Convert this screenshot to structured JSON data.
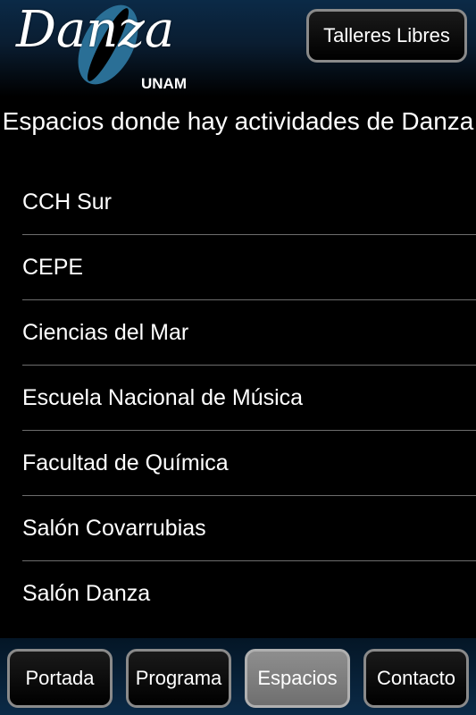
{
  "header": {
    "logo_title": "Danza",
    "logo_subtitle": "UNAM",
    "top_button_label": "Talleres Libres"
  },
  "page": {
    "title": "Espacios donde hay actividades de Danza"
  },
  "spaces": [
    {
      "label": "CCH Sur"
    },
    {
      "label": "CEPE"
    },
    {
      "label": "Ciencias del Mar"
    },
    {
      "label": "Escuela Nacional de Música"
    },
    {
      "label": "Facultad de Química"
    },
    {
      "label": "Salón Covarrubias"
    },
    {
      "label": "Salón Danza"
    }
  ],
  "nav": {
    "tabs": [
      {
        "label": "Portada",
        "active": false
      },
      {
        "label": "Programa",
        "active": false
      },
      {
        "label": "Espacios",
        "active": true
      },
      {
        "label": "Contacto",
        "active": false
      }
    ]
  },
  "colors": {
    "header_blue": "#0b2a47",
    "logo_accent": "#2a6f96",
    "button_border": "#8a8a8a",
    "active_tab": "#7f7f7f"
  }
}
